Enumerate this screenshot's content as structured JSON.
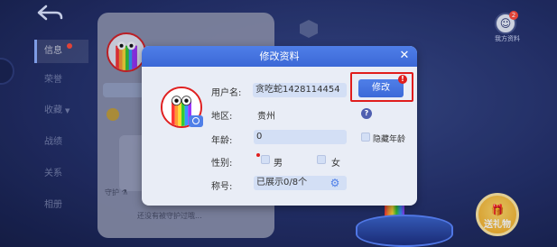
{
  "background": {
    "back_icon": "back-arrow-icon",
    "nav_items": [
      {
        "label": "信息",
        "active": true,
        "has_dot": true
      },
      {
        "label": "荣誉"
      },
      {
        "label": "收藏",
        "chevron": "▼"
      },
      {
        "label": "战绩"
      },
      {
        "label": "关系"
      },
      {
        "label": "相册"
      }
    ],
    "profile_card": {
      "guard_label": "守护 ⚗",
      "footer_text": "还没有被守护过哦..."
    },
    "top_right": {
      "badge_count": "2",
      "label": "我方资料"
    },
    "gift_button": {
      "label": "送礼物",
      "icon": "gift-icon"
    }
  },
  "dialog": {
    "title": "修改资料",
    "close_icon": "close-icon",
    "avatar_icon": "rainbow-avatar",
    "camera_icon": "camera-icon",
    "fields": {
      "username": {
        "label": "用户名:",
        "value": "贪吃蛇1428114454"
      },
      "region": {
        "label": "地区:",
        "value": "贵州"
      },
      "age": {
        "label": "年龄:",
        "value": "0",
        "hide_label": "隐藏年龄"
      },
      "gender": {
        "label": "性别:",
        "male": "男",
        "female": "女"
      },
      "title": {
        "label": "称号:",
        "value": "已展示0/8个"
      }
    },
    "edit_button": {
      "label": "修改",
      "alert": "!"
    },
    "help_icon": {
      "glyph": "?"
    },
    "accent_color": "#3b68d6",
    "highlight_color": "#e01d1d"
  }
}
